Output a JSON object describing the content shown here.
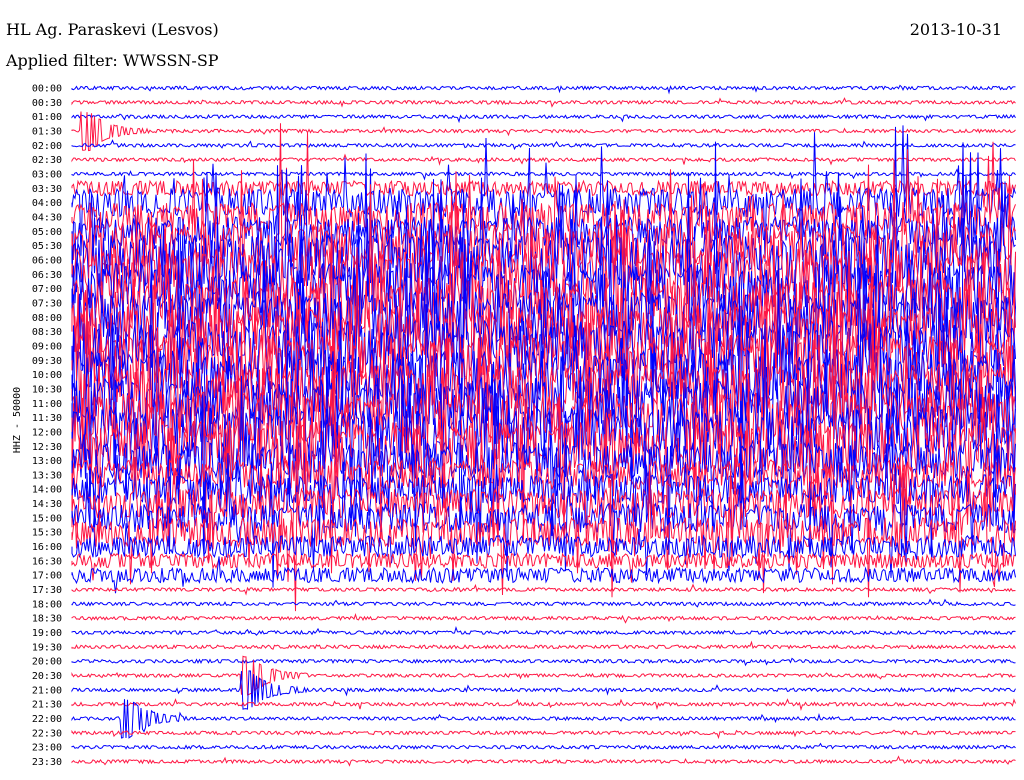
{
  "header": {
    "station": "HL Ag. Paraskevi (Lesvos)",
    "date": "2013-10-31",
    "filter": "Applied filter: WWSSN-SP"
  },
  "axis": {
    "ylabel": "HHZ - 50000"
  },
  "colors": {
    "trace_a": "#0000ff",
    "trace_b": "#ff1744"
  },
  "chart_data": {
    "type": "line",
    "title": "HL Ag. Paraskevi (Lesvos)",
    "ylabel": "HHZ - 50000",
    "row_labels": [
      "00:00",
      "00:30",
      "01:00",
      "01:30",
      "02:00",
      "02:30",
      "03:00",
      "03:30",
      "04:00",
      "04:30",
      "05:00",
      "05:30",
      "06:00",
      "06:30",
      "07:00",
      "07:30",
      "08:00",
      "08:30",
      "09:00",
      "09:30",
      "10:00",
      "10:30",
      "11:00",
      "11:30",
      "12:00",
      "12:30",
      "13:00",
      "13:30",
      "14:00",
      "14:30",
      "15:00",
      "15:30",
      "16:00",
      "16:30",
      "17:00",
      "17:30",
      "18:00",
      "18:30",
      "19:00",
      "19:30",
      "20:00",
      "20:30",
      "21:00",
      "21:30",
      "22:00",
      "22:30",
      "23:00",
      "23:30"
    ],
    "row_colors": [
      "blue",
      "red"
    ],
    "activity_level": [
      1,
      1,
      1,
      1,
      1,
      1,
      1,
      2,
      4,
      4,
      4,
      6,
      7,
      7,
      7,
      7,
      7,
      7,
      7,
      7,
      7,
      7,
      7,
      7,
      7,
      7,
      5,
      4,
      4,
      4,
      4,
      4,
      3,
      2,
      2,
      1,
      1,
      1,
      1,
      1,
      1,
      1,
      1,
      1,
      1,
      1,
      1,
      1
    ],
    "events": [
      {
        "row": "01:30",
        "label": "large event near start"
      },
      {
        "row": "20:30",
        "label": "event"
      },
      {
        "row": "21:00",
        "label": "event"
      },
      {
        "row": "22:00",
        "label": "event"
      }
    ]
  }
}
